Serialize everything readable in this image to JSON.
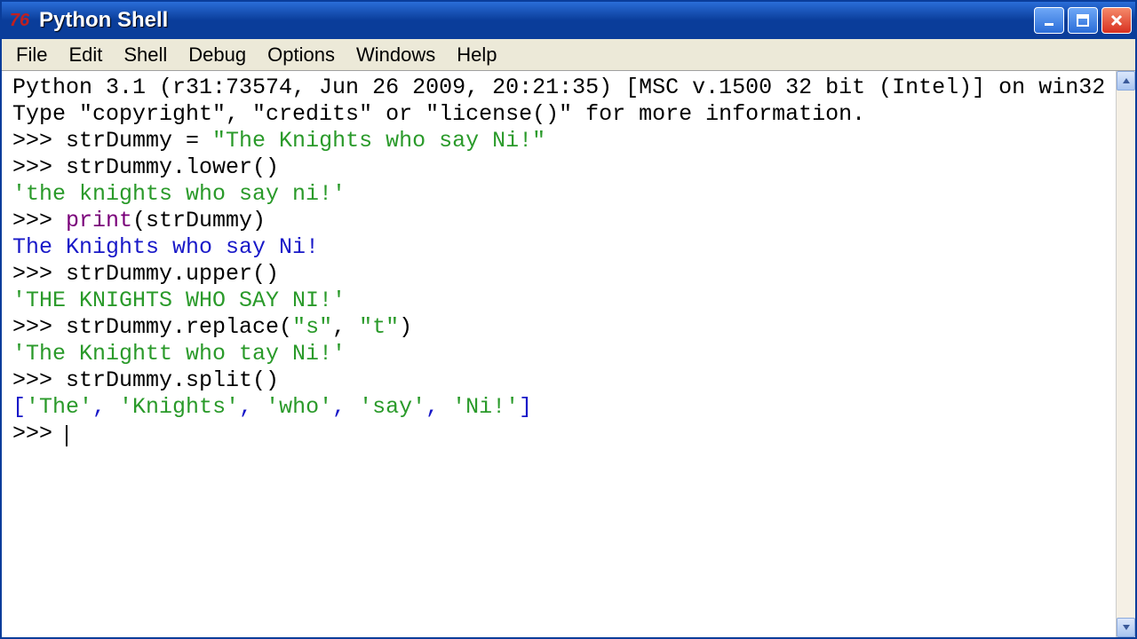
{
  "window": {
    "title": "Python Shell"
  },
  "menubar": {
    "items": [
      "File",
      "Edit",
      "Shell",
      "Debug",
      "Options",
      "Windows",
      "Help"
    ]
  },
  "shell": {
    "banner_line1": "Python 3.1 (r31:73574, Jun 26 2009, 20:21:35) [MSC v.1500 32 bit (Intel)] on win32",
    "banner_line2": "Type \"copyright\", \"credits\" or \"license()\" for more information.",
    "prompt": ">>> ",
    "lines": {
      "l1_pre": "strDummy = ",
      "l1_str": "\"The Knights who say Ni!\"",
      "l2": "strDummy.lower()",
      "l2_out": "'the knights who say ni!'",
      "l3_builtin": "print",
      "l3_rest": "(strDummy)",
      "l3_out": "The Knights who say Ni!",
      "l4": "strDummy.upper()",
      "l4_out": "'THE KNIGHTS WHO SAY NI!'",
      "l5_pre": "strDummy.replace(",
      "l5_s1": "\"s\"",
      "l5_mid": ", ",
      "l5_s2": "\"t\"",
      "l5_post": ")",
      "l5_out": "'The Knightt who tay Ni!'",
      "l6": "strDummy.split()",
      "l6_out_open": "[",
      "l6_out_i0": "'The'",
      "l6_out_c": ", ",
      "l6_out_i1": "'Knights'",
      "l6_out_i2": "'who'",
      "l6_out_i3": "'say'",
      "l6_out_i4": "'Ni!'",
      "l6_out_close": "]"
    }
  }
}
